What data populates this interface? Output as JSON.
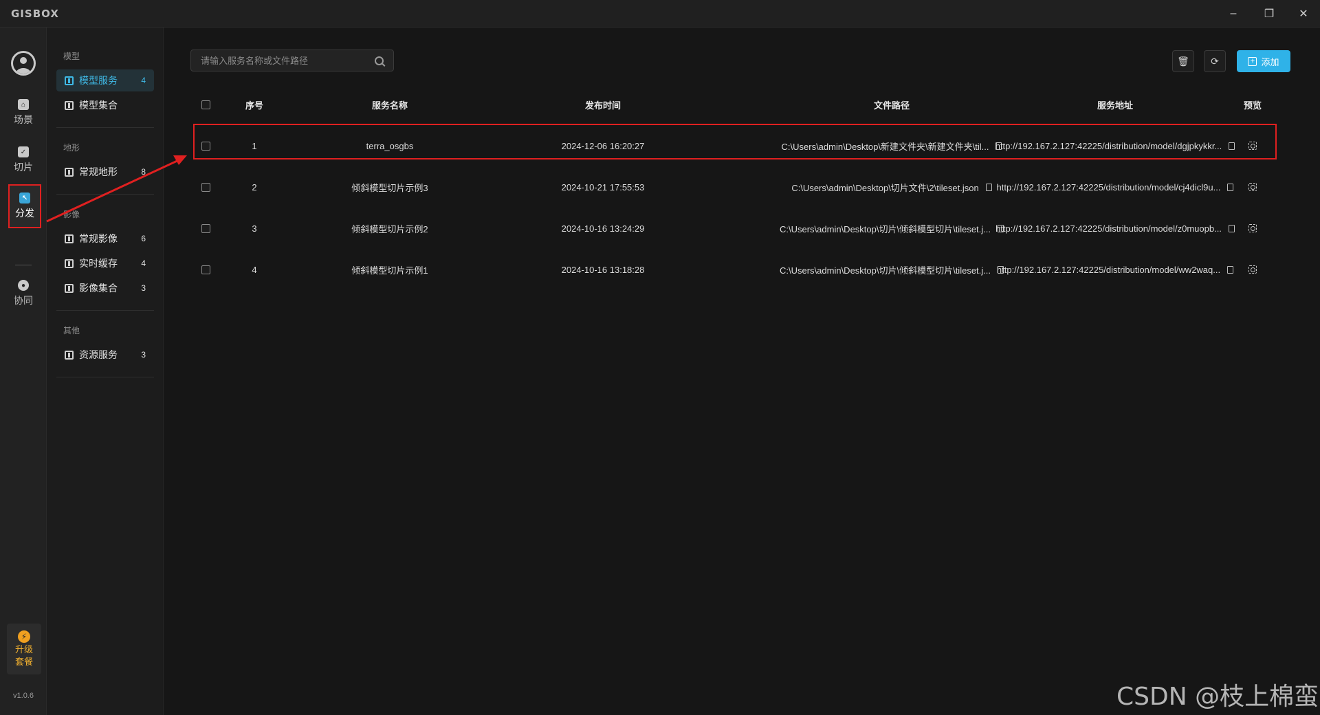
{
  "app": {
    "logo": "GISBOX",
    "version": "v1.0.6"
  },
  "window": {
    "minimize": "–",
    "maximize": "❐",
    "close": "✕"
  },
  "rail": {
    "items": [
      {
        "label": "场景",
        "icon": "scene-icon"
      },
      {
        "label": "切片",
        "icon": "slice-icon"
      },
      {
        "label": "分发",
        "icon": "distribute-icon"
      },
      {
        "label": "协同",
        "icon": "collaborate-icon"
      }
    ],
    "upgrade": {
      "line1": "升级",
      "line2": "套餐",
      "icon": "bolt-icon"
    }
  },
  "sidebar": {
    "groups": [
      {
        "title": "模型",
        "items": [
          {
            "label": "模型服务",
            "count": "4"
          },
          {
            "label": "模型集合",
            "count": ""
          }
        ]
      },
      {
        "title": "地形",
        "items": [
          {
            "label": "常规地形",
            "count": "8"
          }
        ]
      },
      {
        "title": "影像",
        "items": [
          {
            "label": "常规影像",
            "count": "6"
          },
          {
            "label": "实时缓存",
            "count": "4"
          },
          {
            "label": "影像集合",
            "count": "3"
          }
        ]
      },
      {
        "title": "其他",
        "items": [
          {
            "label": "资源服务",
            "count": "3"
          }
        ]
      }
    ]
  },
  "toolbar": {
    "search_placeholder": "请输入服务名称或文件路径",
    "add_label": "添加",
    "add_color": "#2fb2e8"
  },
  "table": {
    "headers": {
      "no": "序号",
      "name": "服务名称",
      "time": "发布时间",
      "path": "文件路径",
      "url": "服务地址",
      "preview": "预览"
    },
    "rows": [
      {
        "no": "1",
        "name": "terra_osgbs",
        "time": "2024-12-06 16:20:27",
        "path": "C:\\Users\\admin\\Desktop\\新建文件夹\\新建文件夹\\til...",
        "url": "http://192.167.2.127:42225/distribution/model/dgjpkykkr..."
      },
      {
        "no": "2",
        "name": "倾斜模型切片示例3",
        "time": "2024-10-21 17:55:53",
        "path": "C:\\Users\\admin\\Desktop\\切片文件\\2\\tileset.json",
        "url": "http://192.167.2.127:42225/distribution/model/cj4dicl9u..."
      },
      {
        "no": "3",
        "name": "倾斜模型切片示例2",
        "time": "2024-10-16 13:24:29",
        "path": "C:\\Users\\admin\\Desktop\\切片\\倾斜模型切片\\tileset.j...",
        "url": "http://192.167.2.127:42225/distribution/model/z0muopb..."
      },
      {
        "no": "4",
        "name": "倾斜模型切片示例1",
        "time": "2024-10-16 13:18:28",
        "path": "C:\\Users\\admin\\Desktop\\切片\\倾斜模型切片\\tileset.j...",
        "url": "http://192.167.2.127:42225/distribution/model/ww2waq..."
      }
    ]
  },
  "watermark": "CSDN @枝上棉蛮",
  "colors": {
    "accent": "#3fb9e6",
    "annotation": "#e02020"
  }
}
